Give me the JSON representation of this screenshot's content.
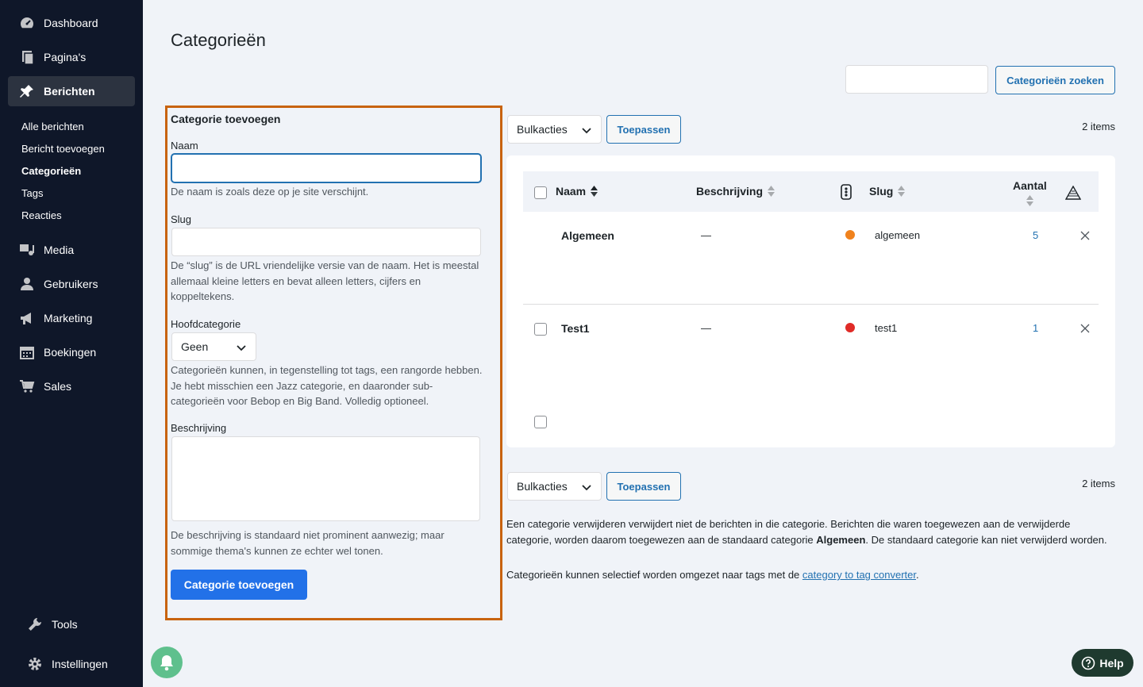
{
  "sidebar": {
    "items": [
      {
        "label": "Dashboard",
        "icon": "dashboard-icon"
      },
      {
        "label": "Pagina's",
        "icon": "pages-icon"
      },
      {
        "label": "Berichten",
        "icon": "pin-icon"
      },
      {
        "label": "Media",
        "icon": "media-icon"
      },
      {
        "label": "Gebruikers",
        "icon": "user-icon"
      },
      {
        "label": "Marketing",
        "icon": "megaphone-icon"
      },
      {
        "label": "Boekingen",
        "icon": "calendar-icon"
      },
      {
        "label": "Sales",
        "icon": "cart-icon"
      },
      {
        "label": "Tools",
        "icon": "wrench-icon"
      },
      {
        "label": "Instellingen",
        "icon": "gear-icon"
      }
    ],
    "submenu": [
      "Alle berichten",
      "Bericht toevoegen",
      "Categorieën",
      "Tags",
      "Reacties"
    ]
  },
  "page": {
    "title": "Categorieën",
    "search_button": "Categorieën zoeken"
  },
  "form": {
    "heading": "Categorie toevoegen",
    "name_label": "Naam",
    "name_value": "",
    "name_help": "De naam is zoals deze op je site verschijnt.",
    "slug_label": "Slug",
    "slug_value": "",
    "slug_help": "De “slug” is de URL vriendelijke versie van de naam. Het is meestal allemaal kleine letters en bevat alleen letters, cijfers en koppeltekens.",
    "parent_label": "Hoofdcategorie",
    "parent_value": "Geen",
    "parent_help": "Categorieën kunnen, in tegenstelling tot tags, een rangorde hebben. Je hebt misschien een Jazz categorie, en daaronder sub-categorieën voor Bebop en Big Band. Volledig optioneel.",
    "desc_label": "Beschrijving",
    "desc_value": "",
    "desc_help": "De beschrijving is standaard niet prominent aanwezig; maar sommige thema's kunnen ze echter wel tonen.",
    "submit": "Categorie toevoegen"
  },
  "table": {
    "bulk_label": "Bulkacties",
    "apply_label": "Toepassen",
    "items_count": "2 items",
    "headers": {
      "name": "Naam",
      "description": "Beschrijving",
      "slug": "Slug",
      "count": "Aantal"
    },
    "rows": [
      {
        "name": "Algemeen",
        "description": "—",
        "color": "#f0821d",
        "slug": "algemeen",
        "count": "5"
      },
      {
        "name": "Test1",
        "description": "—",
        "color": "#e02b27",
        "slug": "test1",
        "count": "1"
      }
    ]
  },
  "footer": {
    "note1_pre": "Een categorie verwijderen verwijdert niet de berichten in die categorie. Berichten die waren toegewezen aan de verwijderde categorie, worden daarom toegewezen aan de standaard categorie ",
    "note1_bold": "Algemeen",
    "note1_post": ". De standaard categorie kan niet verwijderd worden.",
    "note2_pre": "Categorieën kunnen selectief worden omgezet naar tags met de ",
    "note2_link": "category to tag converter",
    "note2_post": "."
  },
  "help_label": "Help",
  "colors": {
    "accent": "#2271b1",
    "primary": "#2271e8",
    "highlight_border": "#c8630f",
    "sidebar_bg": "#0f1729"
  }
}
